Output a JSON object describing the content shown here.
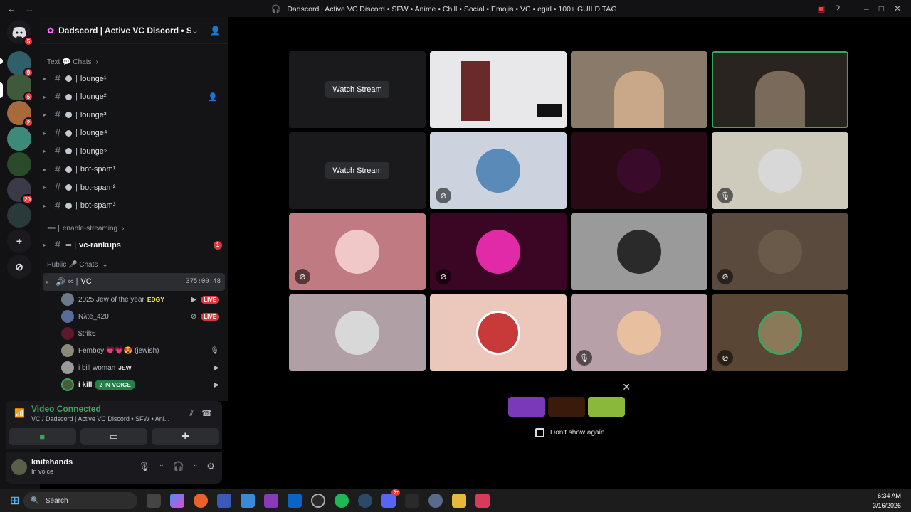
{
  "window": {
    "title": "Dadscord | Active VC Discord • SFW • Anime • Chill • Social • Emojis • VC • egirl • 100+ GUILD TAG"
  },
  "guild": {
    "name": "Dadscord | Active VC Discord • S..."
  },
  "servers": {
    "badges": [
      "5",
      "9",
      "5",
      "2",
      "20"
    ]
  },
  "categories": {
    "text": "Text 💬 Chats",
    "enable_streaming": "enable-streaming",
    "public": "Public 🎤 Chats"
  },
  "channels": [
    {
      "name": "lounge¹"
    },
    {
      "name": "lounge²"
    },
    {
      "name": "lounge³"
    },
    {
      "name": "lounge⁴"
    },
    {
      "name": "lounge⁵"
    },
    {
      "name": "bot-spam¹"
    },
    {
      "name": "bot-spam²"
    },
    {
      "name": "bot-spam³"
    }
  ],
  "rankups": {
    "name": "vc-rankups",
    "badge": "1"
  },
  "voice_channel": {
    "name": "VC",
    "timer": "375:00:48"
  },
  "vc_users": [
    {
      "name": "2025 Jew of the year",
      "tag": "EDGY",
      "live": "LIVE"
    },
    {
      "name": "Nλte_420",
      "live": "LIVE"
    },
    {
      "name": "$trik€"
    },
    {
      "name": "Femboy 💗💗😍 (jewish)"
    },
    {
      "name": "i bill woman",
      "tag": "JEW"
    },
    {
      "name": "i kill",
      "tag": "2 IN VOICE"
    }
  ],
  "voice_panel": {
    "status": "Video Connected",
    "sub": "VC / Dadscord | Active VC Discord • SFW • Ani..."
  },
  "user_panel": {
    "name": "knifehands",
    "status": "In voice"
  },
  "stage": {
    "watch_stream": "Watch Stream"
  },
  "popup": {
    "dont_show": "Don't show again"
  },
  "taskbar": {
    "search": "Search",
    "time": "6:34 AM",
    "date": "3/16/2026",
    "discord_badge": "9+"
  }
}
